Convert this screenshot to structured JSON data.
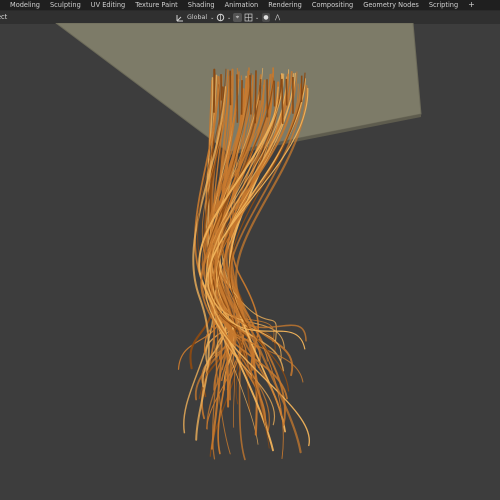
{
  "workspace_tabs": [
    "Modeling",
    "Sculpting",
    "UV Editing",
    "Texture Paint",
    "Shading",
    "Animation",
    "Rendering",
    "Compositing",
    "Geometry Nodes",
    "Scripting"
  ],
  "add_tab_label": "+",
  "header": {
    "mode_label": "ect",
    "orientation": "Global",
    "chevron": "⌄",
    "snap_glyph": "⌖",
    "proportional_glyph": "●",
    "falloff_glyph": "⋀"
  },
  "colors": {
    "background": "#3d3d3d",
    "plane": "#7d7b68",
    "hair": "#c7792e",
    "hair_highlight": "#f0b25a",
    "hair_shadow": "#8a4a14"
  }
}
